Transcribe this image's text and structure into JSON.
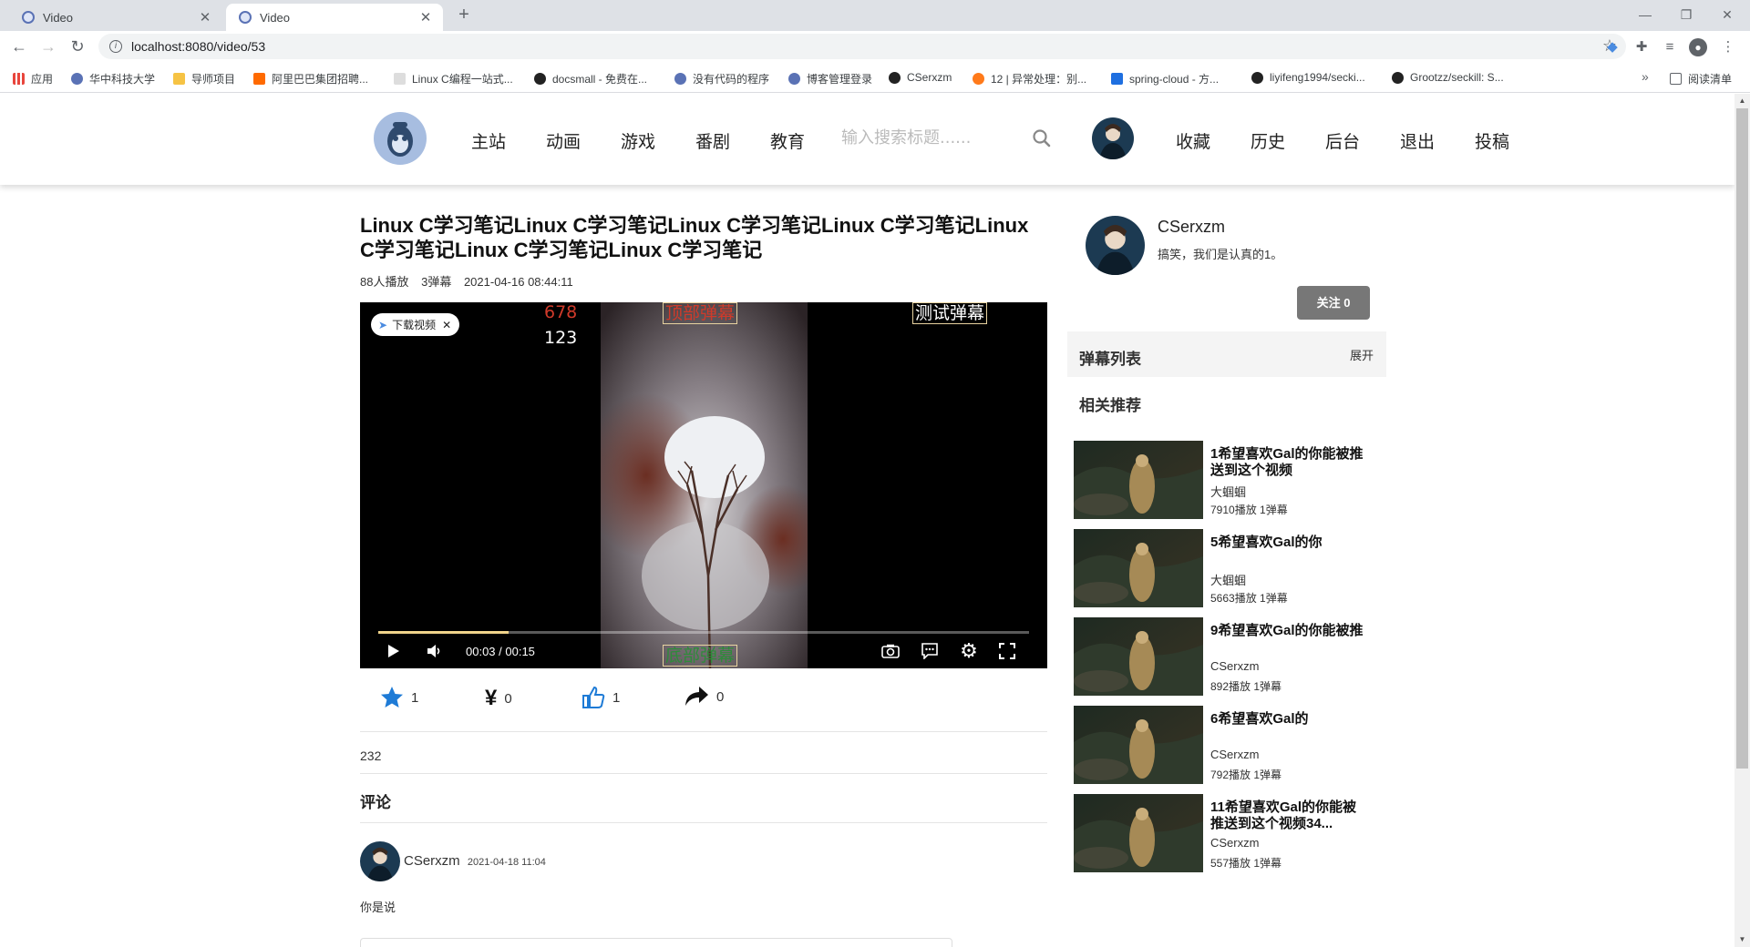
{
  "browser": {
    "tabs": [
      {
        "title": "Video",
        "active": false
      },
      {
        "title": "Video",
        "active": true
      }
    ],
    "url": "localhost:8080/video/53",
    "bookmarks": [
      {
        "label": "应用",
        "color": "#e8453c"
      },
      {
        "label": "华中科技大学",
        "color": "#5a72b5"
      },
      {
        "label": "导师项目",
        "color": "#f6c344"
      },
      {
        "label": "阿里巴巴集团招聘...",
        "color": "#ff6a00"
      },
      {
        "label": "Linux C编程一站式...",
        "color": "#666666"
      },
      {
        "label": "docsmall - 免费在...",
        "color": "#222222"
      },
      {
        "label": "没有代码的程序",
        "color": "#5a72b5"
      },
      {
        "label": "博客管理登录",
        "color": "#5a72b5"
      },
      {
        "label": "CSerxzm",
        "color": "#222222"
      },
      {
        "label": "12 | 异常处理：别...",
        "color": "#ff7a1a"
      },
      {
        "label": "spring-cloud - 方...",
        "color": "#1e6fe0"
      },
      {
        "label": "liyifeng1994/secki...",
        "color": "#222222"
      },
      {
        "label": "Grootzz/seckill: S...",
        "color": "#222222"
      }
    ],
    "reading_list": "阅读清单"
  },
  "header": {
    "nav": [
      "主站",
      "动画",
      "游戏",
      "番剧",
      "教育"
    ],
    "search_placeholder": "输入搜索标题......",
    "user_nav": [
      "收藏",
      "历史",
      "后台",
      "退出",
      "投稿"
    ]
  },
  "video": {
    "title": "Linux C学习笔记Linux C学习笔记Linux C学习笔记Linux C学习笔记Linux C学习笔记Linux C学习笔记Linux C学习笔记",
    "plays": "88人播放",
    "danmaku_count": "3弹幕",
    "date": "2021-04-16 08:44:11",
    "download_label": "下载视频",
    "danmaku": [
      {
        "text": "678",
        "color": "#d03a2a",
        "style": "plain"
      },
      {
        "text": "123",
        "color": "#ffffff",
        "style": "plain"
      },
      {
        "text": "顶部弹幕",
        "color": "#d03a2a",
        "style": "boxed"
      },
      {
        "text": "测试弹幕",
        "color": "#ffffff",
        "style": "boxed"
      },
      {
        "text": "底部弹幕",
        "color": "#2e8b3a",
        "style": "boxed"
      }
    ],
    "progress": 0.2,
    "time": "00:03 / 00:15"
  },
  "actions": {
    "collect": "1",
    "coin": "0",
    "like": "1",
    "share": "0"
  },
  "description": "232",
  "comments": {
    "heading": "评论",
    "items": [
      {
        "user": "CSerxzm",
        "time": "2021-04-18 11:04",
        "text": "你是说"
      }
    ]
  },
  "uploader": {
    "name": "CSerxzm",
    "signature": "搞笑，我们是认真的1。",
    "follow_label": "关注 0"
  },
  "danmu_panel": {
    "title": "弹幕列表",
    "toggle": "展开"
  },
  "recommend": {
    "heading": "相关推荐",
    "items": [
      {
        "title": "1希望喜欢Gal的你能被推送到这个视频",
        "author": "大蝈蝈",
        "stats": "7910播放  1弹幕"
      },
      {
        "title": "5希望喜欢Gal的你",
        "author": "大蝈蝈",
        "stats": "5663播放  1弹幕"
      },
      {
        "title": "9希望喜欢Gal的你能被推",
        "author": "CSerxzm",
        "stats": "892播放  1弹幕"
      },
      {
        "title": "6希望喜欢Gal的",
        "author": "CSerxzm",
        "stats": "792播放  1弹幕"
      },
      {
        "title": "11希望喜欢Gal的你能被推送到这个视频34...",
        "author": "CSerxzm",
        "stats": "557播放  1弹幕"
      }
    ]
  },
  "colors": {
    "follow_button": "#777777",
    "action_icon": "#1e7bd6",
    "progress": "#f0d38a"
  }
}
